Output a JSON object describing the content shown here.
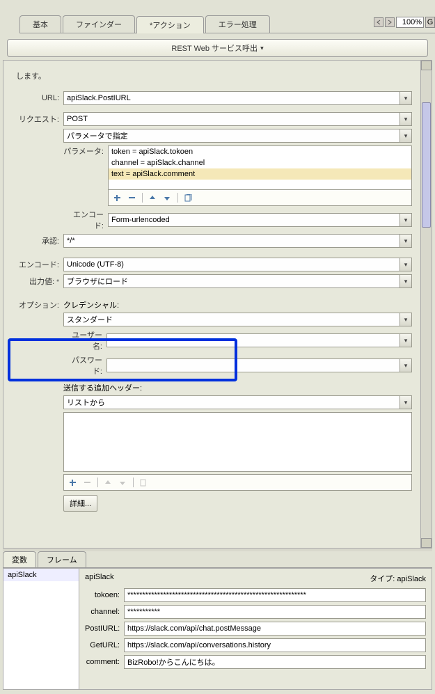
{
  "zoom": {
    "value": "100%",
    "g": "G"
  },
  "tabs": {
    "basic": "基本",
    "finder": "ファインダー",
    "action": "*アクション",
    "error": "エラー処理"
  },
  "header_dropdown": "REST Web サービス呼出",
  "continue": "します。",
  "labels": {
    "url": "URL:",
    "request": "リクエスト:",
    "parameter": "パラメータ:",
    "encode": "エンコード:",
    "accept": "承認:",
    "encode2": "エンコード:",
    "output": "出力値:",
    "options": "オプション:",
    "credential": "クレデンシャル:",
    "standard": "スタンダード",
    "username": "ユーザー名:",
    "password": "パスワード:",
    "additional_headers": "送信する追加ヘッダー:",
    "from_list": "リストから",
    "details": "詳細..."
  },
  "fields": {
    "url": "apiSlack.PostIURL",
    "request_method": "POST",
    "param_spec": "パラメータで指定",
    "encode": "Form-urlencoded",
    "accept": "*/*",
    "encode2": "Unicode (UTF-8)",
    "output": "ブラウザにロード"
  },
  "params": {
    "items": [
      "token = apiSlack.tokoen",
      "channel = apiSlack.channel",
      "text = apiSlack.comment"
    ]
  },
  "bottom_tabs": {
    "vars": "変数",
    "frames": "フレーム"
  },
  "var_list": {
    "item0": "apiSlack"
  },
  "var_detail": {
    "name": "apiSlack",
    "type_label": "タイプ: apiSlack",
    "rows": {
      "tokoen": {
        "label": "tokoen:",
        "value": "************************************************************"
      },
      "channel": {
        "label": "channel:",
        "value": "***********"
      },
      "postiurl": {
        "label": "PostIURL:",
        "value": "https://slack.com/api/chat.postMessage"
      },
      "geturl": {
        "label": "GetURL:",
        "value": "https://slack.com/api/conversations.history"
      },
      "comment": {
        "label": "comment:",
        "value": "BizRobo!からこんにちは。"
      }
    }
  }
}
